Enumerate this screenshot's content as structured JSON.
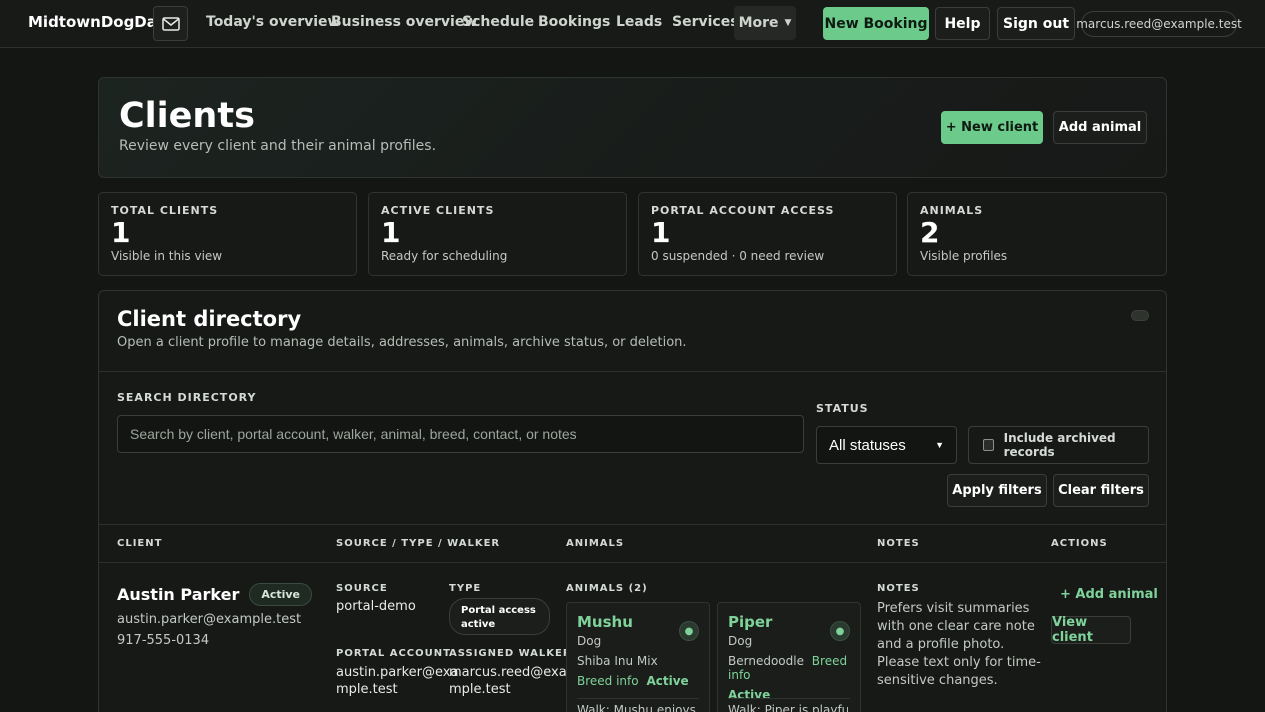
{
  "nav": {
    "brand": "MidtownDogDad",
    "links": [
      "Today's overview",
      "Business overview",
      "Schedule",
      "Bookings",
      "Leads",
      "Services"
    ],
    "more_label": "More",
    "new_booking": "New Booking",
    "help": "Help",
    "sign_out": "Sign out",
    "user_email": "marcus.reed@example.test"
  },
  "hero": {
    "title": "Clients",
    "subtitle": "Review every client and their animal profiles.",
    "new_client": "+ New client",
    "add_animal": "Add animal"
  },
  "stats": [
    {
      "label": "TOTAL CLIENTS",
      "value": "1",
      "sub": "Visible in this view"
    },
    {
      "label": "ACTIVE CLIENTS",
      "value": "1",
      "sub": "Ready for scheduling"
    },
    {
      "label": "PORTAL ACCOUNT ACCESS",
      "value": "1",
      "sub": "0 suspended · 0 need review"
    },
    {
      "label": "ANIMALS",
      "value": "2",
      "sub": "Visible profiles"
    }
  ],
  "directory": {
    "title": "Client directory",
    "description": "Open a client profile to manage details, addresses, animals, archive status, or deletion.",
    "search_label": "SEARCH DIRECTORY",
    "search_placeholder": "Search by client, portal account, walker, animal, breed, contact, or notes",
    "status_label": "STATUS",
    "status_value": "All statuses",
    "include_archived": "Include archived records",
    "apply_filters": "Apply filters",
    "clear_filters": "Clear filters",
    "columns": [
      "CLIENT",
      "SOURCE / TYPE / WALKER",
      "ANIMALS",
      "NOTES",
      "ACTIONS"
    ]
  },
  "client": {
    "name": "Austin Parker",
    "status": "Active",
    "email": "austin.parker@example.test",
    "phone": "917-555-0134",
    "source_label": "SOURCE",
    "source": "portal-demo",
    "type_label": "TYPE",
    "type_line1": "Portal access",
    "type_line2": "active",
    "portal_label": "PORTAL ACCOUNT",
    "portal_line1": "austin.parker@exa",
    "portal_line2": "mple.test",
    "walker_label": "ASSIGNED WALKER",
    "walker_line1": "marcus.reed@exa",
    "walker_line2": "mple.test",
    "animals_label": "ANIMALS (2)",
    "animals": [
      {
        "name": "Mushu",
        "species": "Dog",
        "breed": "Shiba Inu Mix",
        "breed_info": "Breed info",
        "status": "Active",
        "walk": "Walk: Mushu enjoys a"
      },
      {
        "name": "Piper",
        "species": "Dog",
        "breed": "Bernedoodle",
        "breed_info": "Breed info",
        "status": "Active",
        "walk": "Walk: Piper is playful"
      }
    ],
    "notes_label": "NOTES",
    "notes": "Prefers visit summaries with one clear care note and a profile photo. Please text only for time-sensitive changes.",
    "add_animal": "+ Add animal",
    "view_client": "View client"
  },
  "colors": {
    "accent": "#6ccb8b",
    "link": "#7fd39a",
    "background": "#141614"
  }
}
